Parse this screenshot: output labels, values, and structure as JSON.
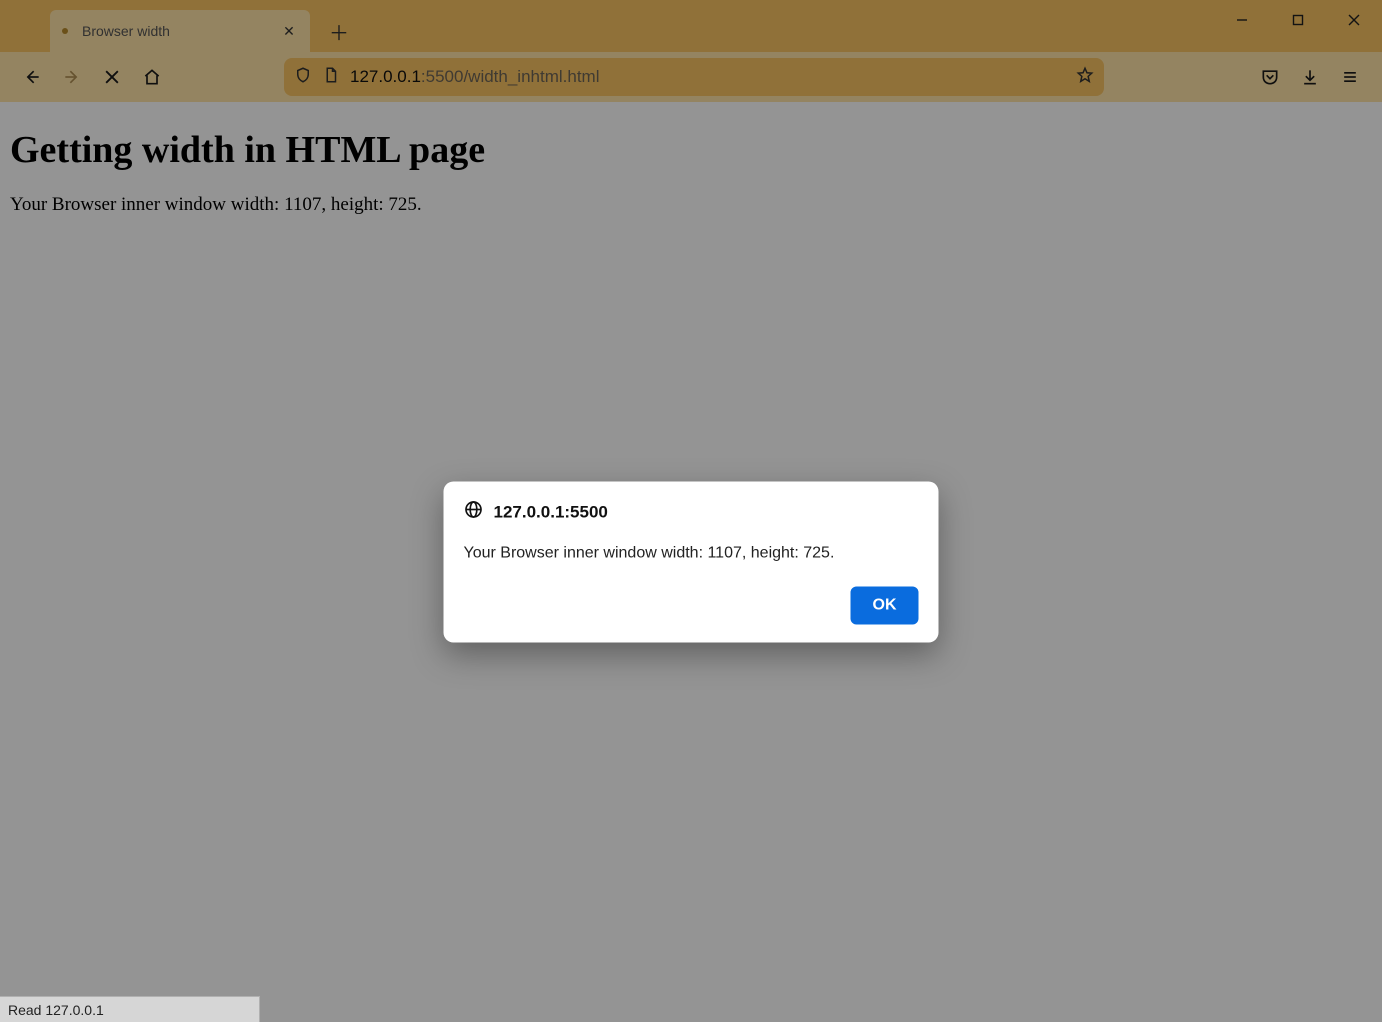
{
  "tab": {
    "title": "Browser width"
  },
  "url": {
    "host": "127.0.0.1",
    "rest": ":5500/width_inhtml.html"
  },
  "page": {
    "heading": "Getting width in HTML page",
    "paragraph": "Your Browser inner window width: 1107, height: 725."
  },
  "dialog": {
    "origin": "127.0.0.1:5500",
    "message": "Your Browser inner window width: 1107, height: 725.",
    "ok_label": "OK"
  },
  "status": "Read 127.0.0.1"
}
